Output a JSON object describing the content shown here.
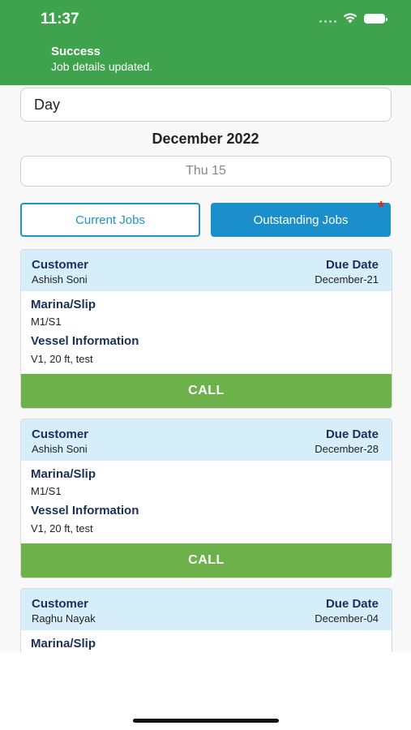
{
  "status_bar": {
    "time": "11:37"
  },
  "toast": {
    "title": "Success",
    "message": "Job details updated."
  },
  "filters": {
    "period": "Day",
    "month": "December 2022",
    "date": "Thu 15"
  },
  "tabs": [
    {
      "label": "Current Jobs",
      "active": false
    },
    {
      "label": "Outstanding Jobs",
      "active": true,
      "badge": "*"
    }
  ],
  "labels": {
    "customer": "Customer",
    "due_date": "Due Date",
    "marina": "Marina/Slip",
    "vessel": "Vessel Information",
    "call": "CALL"
  },
  "jobs": [
    {
      "customer": "Ashish Soni",
      "due": "December-21",
      "marina": "M1/S1",
      "vessel": "V1, 20 ft, test"
    },
    {
      "customer": "Ashish Soni",
      "due": "December-28",
      "marina": "M1/S1",
      "vessel": "V1, 20 ft, test"
    },
    {
      "customer": "Raghu Nayak",
      "due": "December-04"
    }
  ],
  "colors": {
    "banner": "#3fa34d",
    "tab_active": "#1b8fcb",
    "card_header": "#d6eefa",
    "call_button": "#6db14a",
    "label_text": "#1b2f5a"
  }
}
